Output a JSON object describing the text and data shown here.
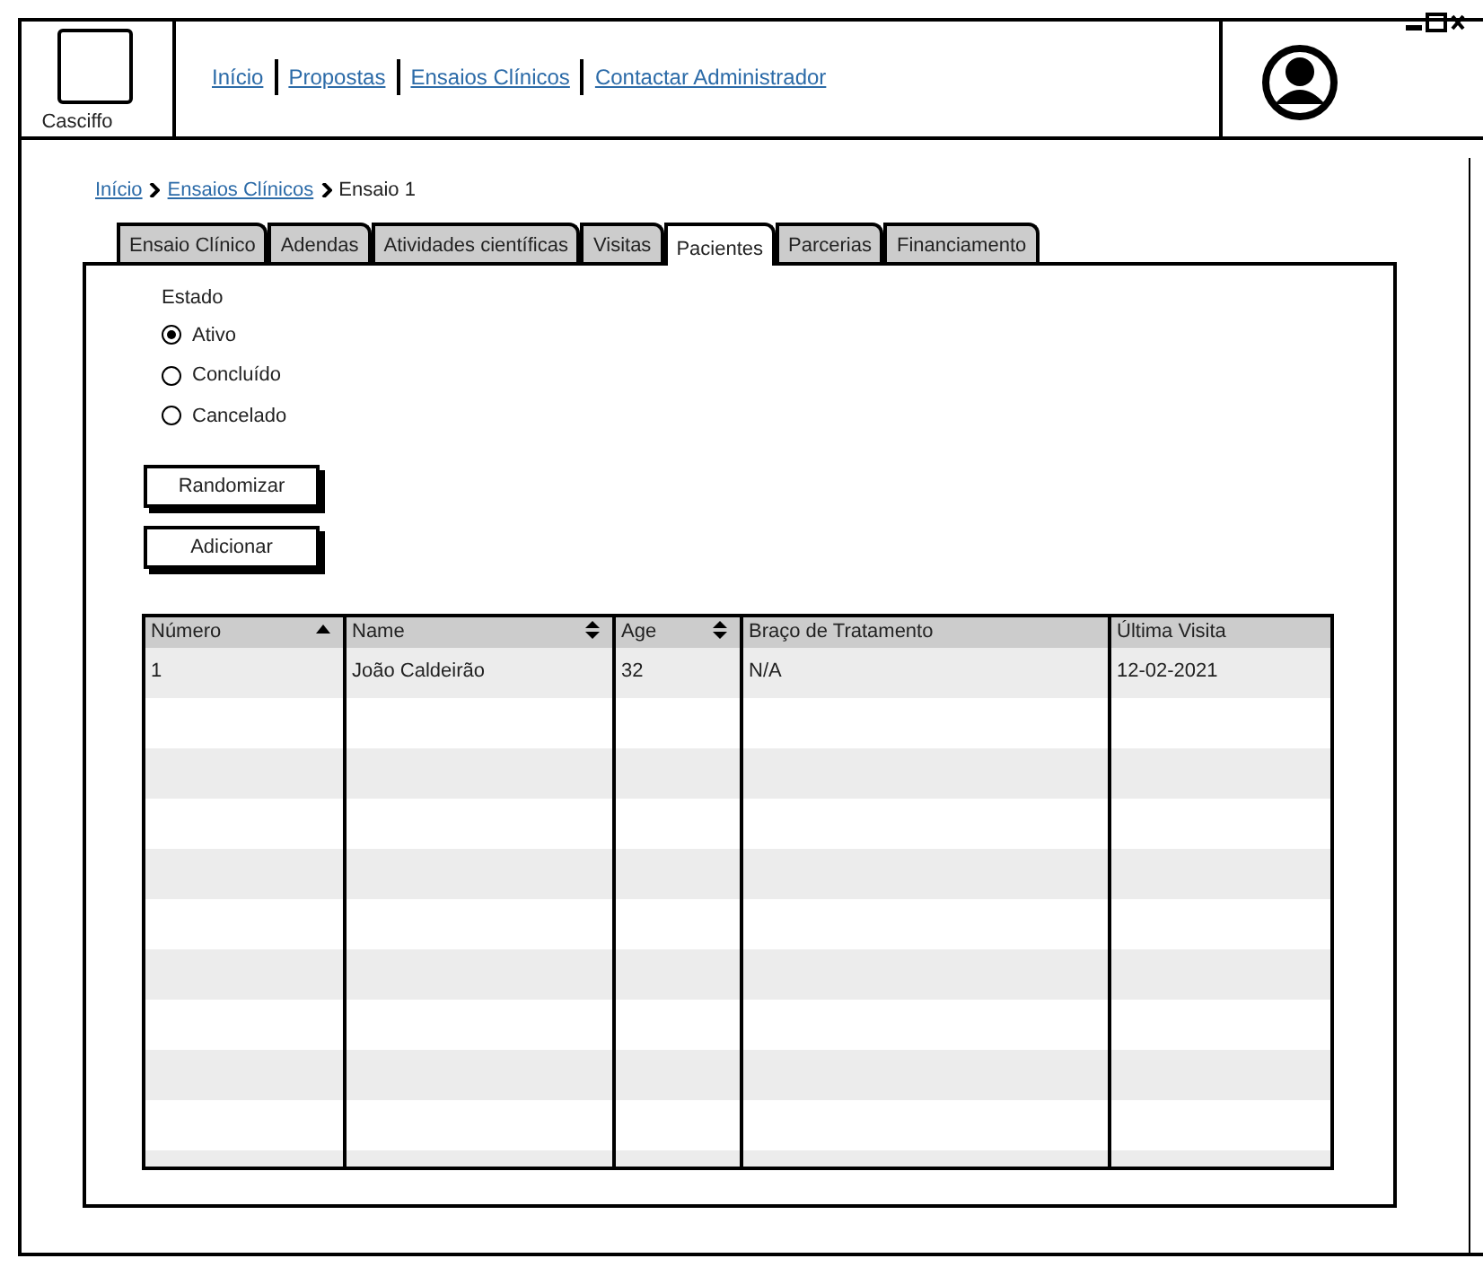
{
  "logo": {
    "label": "Casciffo"
  },
  "nav": [
    {
      "label": "Início"
    },
    {
      "label": "Propostas"
    },
    {
      "label": "Ensaios Clínicos"
    },
    {
      "label": "Contactar Administrador"
    }
  ],
  "breadcrumb": [
    {
      "label": "Início",
      "kind": "link"
    },
    {
      "label": "Ensaios Clínicos",
      "kind": "link"
    },
    {
      "label": "Ensaio 1",
      "kind": "current"
    }
  ],
  "tabs": [
    {
      "label": "Ensaio Clínico",
      "selected": false
    },
    {
      "label": "Adendas",
      "selected": false
    },
    {
      "label": "Atividades científicas",
      "selected": false
    },
    {
      "label": "Visitas",
      "selected": false
    },
    {
      "label": "Pacientes",
      "selected": true
    },
    {
      "label": "Parcerias",
      "selected": false
    },
    {
      "label": "Financiamento",
      "selected": false
    }
  ],
  "status_group": {
    "label": "Estado",
    "options": [
      {
        "label": "Ativo",
        "selected": true
      },
      {
        "label": "Concluído",
        "selected": false
      },
      {
        "label": "Cancelado",
        "selected": false
      }
    ]
  },
  "buttons": [
    {
      "label": "Randomizar"
    },
    {
      "label": "Adicionar"
    }
  ],
  "table": {
    "columns": [
      {
        "label": "Número",
        "kind": "ascending"
      },
      {
        "label": "Name",
        "kind": "sortable"
      },
      {
        "label": "Age",
        "kind": "sortable"
      },
      {
        "label": "Braço de Tratamento",
        "kind": "plain"
      },
      {
        "label": "Última Visita",
        "kind": "plain"
      }
    ],
    "rows": [
      [
        "1",
        "João Caldeirão",
        "32",
        "N/A",
        "12-02-2021"
      ]
    ]
  }
}
